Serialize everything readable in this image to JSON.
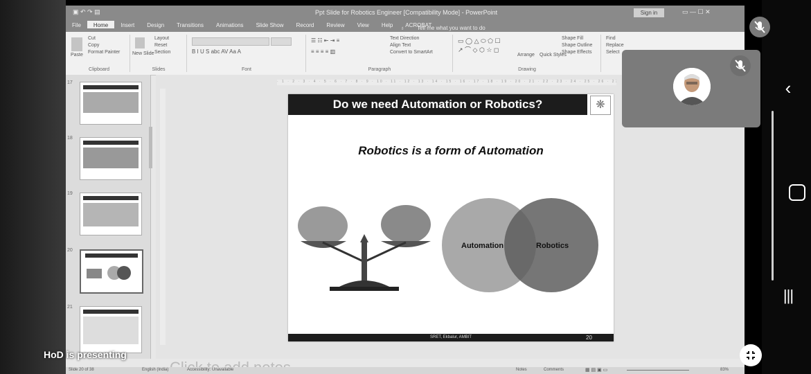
{
  "powerpoint": {
    "title": "Ppt Slide for Robotics Engineer [Compatibility Mode] - PowerPoint",
    "sign_in": "Sign in",
    "tabs": [
      "File",
      "Home",
      "Insert",
      "Design",
      "Transitions",
      "Animations",
      "Slide Show",
      "Record",
      "Review",
      "View",
      "Help",
      "ACROBAT"
    ],
    "active_tab": "Home",
    "tell_me": "Tell me what you want to do",
    "ribbon": {
      "clipboard": {
        "label": "Clipboard",
        "paste": "Paste",
        "cut": "Cut",
        "copy": "Copy",
        "format_painter": "Format Painter"
      },
      "slides": {
        "label": "Slides",
        "new_slide": "New Slide",
        "layout": "Layout",
        "reset": "Reset",
        "section": "Section"
      },
      "font": {
        "label": "Font"
      },
      "paragraph": {
        "label": "Paragraph",
        "text_direction": "Text Direction",
        "align_text": "Align Text",
        "smartart": "Convert to SmartArt"
      },
      "drawing": {
        "label": "Drawing",
        "arrange": "Arrange",
        "quick_styles": "Quick Styles",
        "shape_fill": "Shape Fill",
        "shape_outline": "Shape Outline",
        "shape_effects": "Shape Effects"
      },
      "editing": {
        "find": "Find",
        "replace": "Replace",
        "select": "Select"
      }
    },
    "thumbnails": [
      {
        "number": "17"
      },
      {
        "number": "18"
      },
      {
        "number": "19"
      },
      {
        "number": "20",
        "selected": true
      },
      {
        "number": "21"
      }
    ],
    "slide": {
      "header": "Do we need Automation or Robotics?",
      "subtitle": "Robotics is a form of Automation",
      "venn_left": "Automation",
      "venn_right": "Robotics",
      "footer_center": "SRET, Ekbalur, AMBIT",
      "page_number": "20"
    },
    "notes_placeholder": "Click to add notes",
    "status": {
      "slide_info": "Slide 20 of 38",
      "language": "English (India)",
      "accessibility": "Accessibility: Unavailable",
      "notes": "Notes",
      "comments": "Comments",
      "zoom": "83%"
    }
  },
  "meeting": {
    "presenting_label": "HoD is presenting"
  },
  "colors": {
    "venn_left": "#a9a9a9",
    "venn_right": "#5e5e5e",
    "video_tile": "#7b7b7b",
    "slide_header_bg": "#1c1c1c"
  }
}
